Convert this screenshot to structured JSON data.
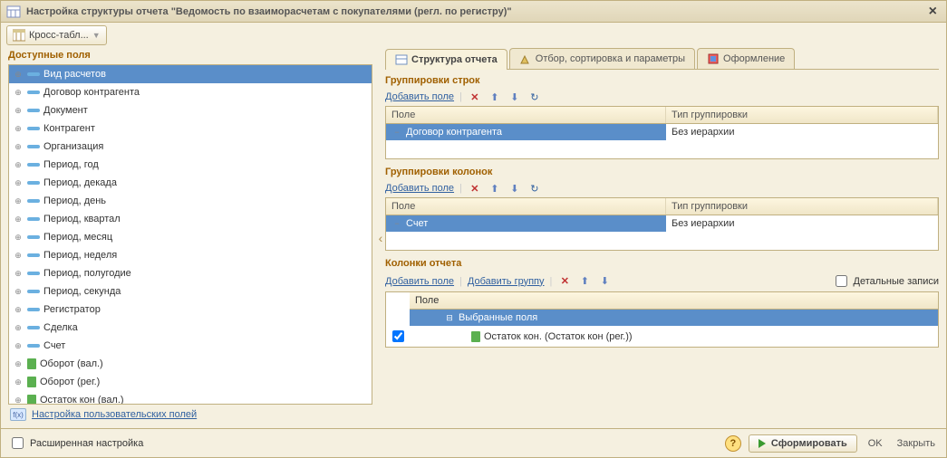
{
  "title": "Настройка структуры отчета \"Ведомость по взаиморасчетам с покупателями (регл. по регистру)\"",
  "toolbar": {
    "cross_label": "Кросс-табл..."
  },
  "left": {
    "title": "Доступные поля",
    "items": [
      {
        "label": "Вид расчетов",
        "selected": true,
        "ico": "dash"
      },
      {
        "label": "Договор контрагента",
        "ico": "dash"
      },
      {
        "label": "Документ",
        "ico": "dash"
      },
      {
        "label": "Контрагент",
        "ico": "dash"
      },
      {
        "label": "Организация",
        "ico": "dash"
      },
      {
        "label": "Период, год",
        "ico": "dash"
      },
      {
        "label": "Период, декада",
        "ico": "dash"
      },
      {
        "label": "Период, день",
        "ico": "dash"
      },
      {
        "label": "Период, квартал",
        "ico": "dash"
      },
      {
        "label": "Период, месяц",
        "ico": "dash"
      },
      {
        "label": "Период, неделя",
        "ico": "dash"
      },
      {
        "label": "Период, полугодие",
        "ico": "dash"
      },
      {
        "label": "Период, секунда",
        "ico": "dash"
      },
      {
        "label": "Регистратор",
        "ico": "dash"
      },
      {
        "label": "Сделка",
        "ico": "dash"
      },
      {
        "label": "Счет",
        "ico": "dash"
      },
      {
        "label": "Оборот (вал.)",
        "ico": "green"
      },
      {
        "label": "Оборот (рег.)",
        "ico": "green"
      },
      {
        "label": "Остаток кон (вал.)",
        "ico": "green"
      }
    ],
    "fx_label": "Настройка пользовательских полей"
  },
  "tabs": [
    {
      "label": "Структура отчета",
      "active": true
    },
    {
      "label": "Отбор, сортировка и параметры"
    },
    {
      "label": "Оформление"
    }
  ],
  "rows_group": {
    "title": "Группировки строк",
    "add_label": "Добавить поле",
    "col_field": "Поле",
    "col_type": "Тип группировки",
    "row_field": "Договор контрагента",
    "row_type": "Без иерархии"
  },
  "cols_group": {
    "title": "Группировки колонок",
    "add_label": "Добавить поле",
    "col_field": "Поле",
    "col_type": "Тип группировки",
    "row_field": "Счет",
    "row_type": "Без иерархии"
  },
  "report_cols": {
    "title": "Колонки отчета",
    "add_field": "Добавить поле",
    "add_group": "Добавить группу",
    "detail": "Детальные записи",
    "head": "Поле",
    "sel_fields": "Выбранные поля",
    "item": "Остаток кон. (Остаток кон (рег.))"
  },
  "footer": {
    "ext": "Расширенная настройка",
    "form": "Сформировать",
    "ok": "OK",
    "close": "Закрыть"
  }
}
